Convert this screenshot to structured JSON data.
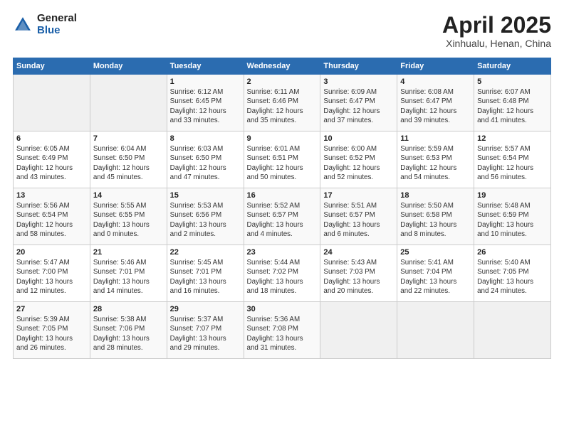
{
  "header": {
    "logo": {
      "general": "General",
      "blue": "Blue"
    },
    "title": "April 2025",
    "location": "Xinhualu, Henan, China"
  },
  "weekdays": [
    "Sunday",
    "Monday",
    "Tuesday",
    "Wednesday",
    "Thursday",
    "Friday",
    "Saturday"
  ],
  "weeks": [
    [
      {
        "day": null,
        "info": null
      },
      {
        "day": null,
        "info": null
      },
      {
        "day": "1",
        "info": "Sunrise: 6:12 AM\nSunset: 6:45 PM\nDaylight: 12 hours\nand 33 minutes."
      },
      {
        "day": "2",
        "info": "Sunrise: 6:11 AM\nSunset: 6:46 PM\nDaylight: 12 hours\nand 35 minutes."
      },
      {
        "day": "3",
        "info": "Sunrise: 6:09 AM\nSunset: 6:47 PM\nDaylight: 12 hours\nand 37 minutes."
      },
      {
        "day": "4",
        "info": "Sunrise: 6:08 AM\nSunset: 6:47 PM\nDaylight: 12 hours\nand 39 minutes."
      },
      {
        "day": "5",
        "info": "Sunrise: 6:07 AM\nSunset: 6:48 PM\nDaylight: 12 hours\nand 41 minutes."
      }
    ],
    [
      {
        "day": "6",
        "info": "Sunrise: 6:05 AM\nSunset: 6:49 PM\nDaylight: 12 hours\nand 43 minutes."
      },
      {
        "day": "7",
        "info": "Sunrise: 6:04 AM\nSunset: 6:50 PM\nDaylight: 12 hours\nand 45 minutes."
      },
      {
        "day": "8",
        "info": "Sunrise: 6:03 AM\nSunset: 6:50 PM\nDaylight: 12 hours\nand 47 minutes."
      },
      {
        "day": "9",
        "info": "Sunrise: 6:01 AM\nSunset: 6:51 PM\nDaylight: 12 hours\nand 50 minutes."
      },
      {
        "day": "10",
        "info": "Sunrise: 6:00 AM\nSunset: 6:52 PM\nDaylight: 12 hours\nand 52 minutes."
      },
      {
        "day": "11",
        "info": "Sunrise: 5:59 AM\nSunset: 6:53 PM\nDaylight: 12 hours\nand 54 minutes."
      },
      {
        "day": "12",
        "info": "Sunrise: 5:57 AM\nSunset: 6:54 PM\nDaylight: 12 hours\nand 56 minutes."
      }
    ],
    [
      {
        "day": "13",
        "info": "Sunrise: 5:56 AM\nSunset: 6:54 PM\nDaylight: 12 hours\nand 58 minutes."
      },
      {
        "day": "14",
        "info": "Sunrise: 5:55 AM\nSunset: 6:55 PM\nDaylight: 13 hours\nand 0 minutes."
      },
      {
        "day": "15",
        "info": "Sunrise: 5:53 AM\nSunset: 6:56 PM\nDaylight: 13 hours\nand 2 minutes."
      },
      {
        "day": "16",
        "info": "Sunrise: 5:52 AM\nSunset: 6:57 PM\nDaylight: 13 hours\nand 4 minutes."
      },
      {
        "day": "17",
        "info": "Sunrise: 5:51 AM\nSunset: 6:57 PM\nDaylight: 13 hours\nand 6 minutes."
      },
      {
        "day": "18",
        "info": "Sunrise: 5:50 AM\nSunset: 6:58 PM\nDaylight: 13 hours\nand 8 minutes."
      },
      {
        "day": "19",
        "info": "Sunrise: 5:48 AM\nSunset: 6:59 PM\nDaylight: 13 hours\nand 10 minutes."
      }
    ],
    [
      {
        "day": "20",
        "info": "Sunrise: 5:47 AM\nSunset: 7:00 PM\nDaylight: 13 hours\nand 12 minutes."
      },
      {
        "day": "21",
        "info": "Sunrise: 5:46 AM\nSunset: 7:01 PM\nDaylight: 13 hours\nand 14 minutes."
      },
      {
        "day": "22",
        "info": "Sunrise: 5:45 AM\nSunset: 7:01 PM\nDaylight: 13 hours\nand 16 minutes."
      },
      {
        "day": "23",
        "info": "Sunrise: 5:44 AM\nSunset: 7:02 PM\nDaylight: 13 hours\nand 18 minutes."
      },
      {
        "day": "24",
        "info": "Sunrise: 5:43 AM\nSunset: 7:03 PM\nDaylight: 13 hours\nand 20 minutes."
      },
      {
        "day": "25",
        "info": "Sunrise: 5:41 AM\nSunset: 7:04 PM\nDaylight: 13 hours\nand 22 minutes."
      },
      {
        "day": "26",
        "info": "Sunrise: 5:40 AM\nSunset: 7:05 PM\nDaylight: 13 hours\nand 24 minutes."
      }
    ],
    [
      {
        "day": "27",
        "info": "Sunrise: 5:39 AM\nSunset: 7:05 PM\nDaylight: 13 hours\nand 26 minutes."
      },
      {
        "day": "28",
        "info": "Sunrise: 5:38 AM\nSunset: 7:06 PM\nDaylight: 13 hours\nand 28 minutes."
      },
      {
        "day": "29",
        "info": "Sunrise: 5:37 AM\nSunset: 7:07 PM\nDaylight: 13 hours\nand 29 minutes."
      },
      {
        "day": "30",
        "info": "Sunrise: 5:36 AM\nSunset: 7:08 PM\nDaylight: 13 hours\nand 31 minutes."
      },
      {
        "day": null,
        "info": null
      },
      {
        "day": null,
        "info": null
      },
      {
        "day": null,
        "info": null
      }
    ]
  ]
}
